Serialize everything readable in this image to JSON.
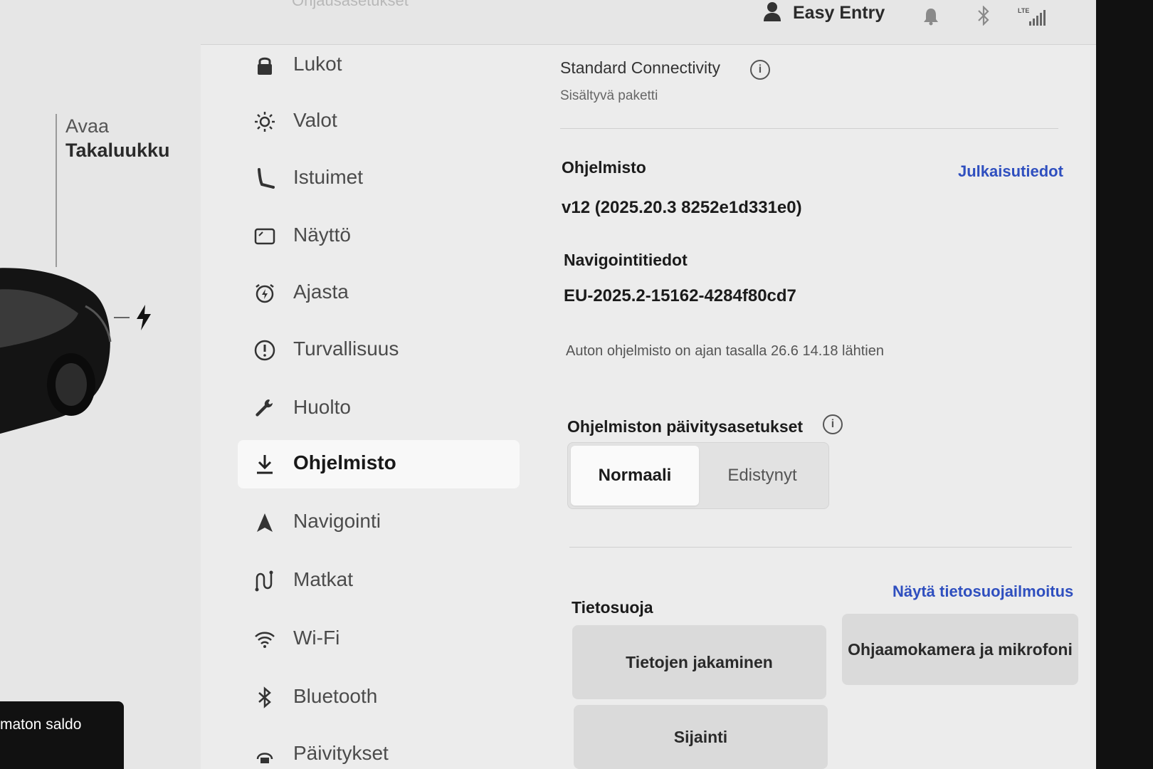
{
  "car_panel": {
    "trunk_action": "Avaa",
    "trunk_label": "Takaluukku",
    "balance_label": "maton saldo"
  },
  "topbar": {
    "ghost_title": "Ohjausasetukset",
    "profile_name": "Easy Entry",
    "lte_label": "LTE"
  },
  "menu": {
    "items": [
      {
        "label": "Lukot",
        "icon": "lock-icon"
      },
      {
        "label": "Valot",
        "icon": "light-icon"
      },
      {
        "label": "Istuimet",
        "icon": "seat-icon"
      },
      {
        "label": "Näyttö",
        "icon": "display-icon"
      },
      {
        "label": "Ajasta",
        "icon": "schedule-icon"
      },
      {
        "label": "Turvallisuus",
        "icon": "safety-icon"
      },
      {
        "label": "Huolto",
        "icon": "wrench-icon"
      },
      {
        "label": "Ohjelmisto",
        "icon": "download-icon",
        "active": true
      },
      {
        "label": "Navigointi",
        "icon": "navigation-icon"
      },
      {
        "label": "Matkat",
        "icon": "trips-icon"
      },
      {
        "label": "Wi-Fi",
        "icon": "wifi-icon"
      },
      {
        "label": "Bluetooth",
        "icon": "bluetooth-icon"
      },
      {
        "label": "Päivitykset",
        "icon": "updates-icon"
      }
    ]
  },
  "content": {
    "connectivity_title": "Standard Connectivity",
    "connectivity_sub": "Sisältyvä paketti",
    "software_title": "Ohjelmisto",
    "release_notes_link": "Julkaisutiedot",
    "software_version": "v12 (2025.20.3 8252e1d331e0)",
    "nav_data_title": "Navigointitiedot",
    "nav_data_value": "EU-2025.2-15162-4284f80cd7",
    "up_to_date_note": "Auton ohjelmisto on ajan tasalla 26.6 14.18 lähtien",
    "update_prefs_title": "Ohjelmiston päivitysasetukset",
    "update_options": [
      "Normaali",
      "Edistynyt"
    ],
    "update_selected": "Normaali",
    "privacy_title": "Tietosuoja",
    "privacy_notice_link": "Näytä tietosuojailmoitus",
    "privacy_buttons": [
      "Tietojen jakaminen",
      "Ohjaamokamera ja mikrofoni",
      "Sijainti"
    ]
  },
  "colors": {
    "link": "#2f4fbf",
    "active_menu_bg": "#f8f8f8",
    "background": "#ececec"
  }
}
